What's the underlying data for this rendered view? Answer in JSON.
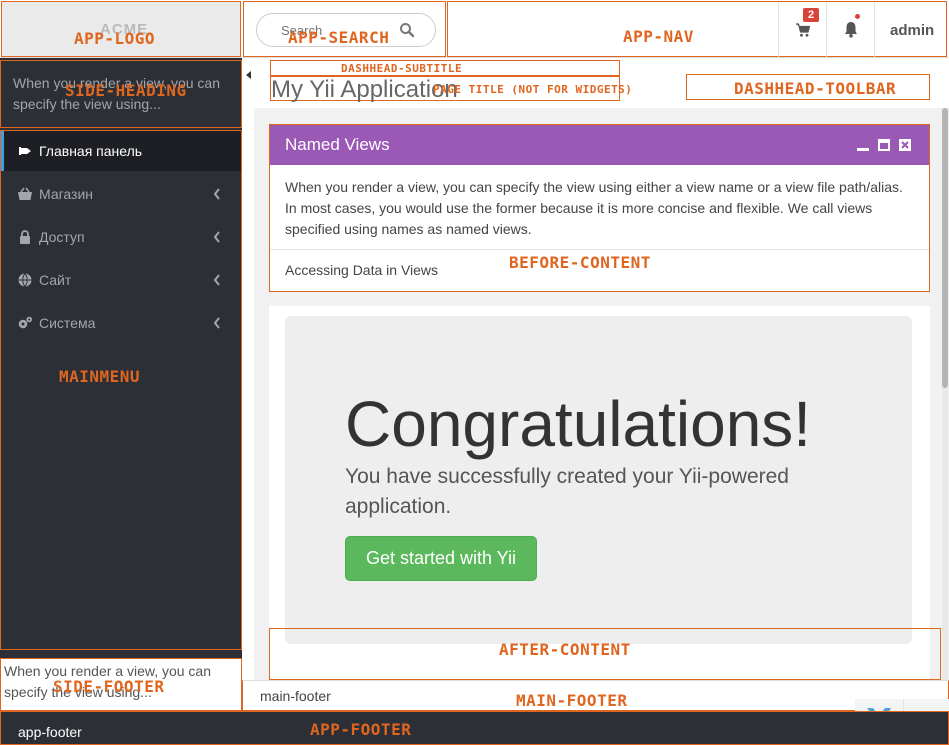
{
  "header": {
    "logo_text": "ACME",
    "search_placeholder": "Search",
    "cart_badge": "2",
    "user_name": "admin"
  },
  "sidebar": {
    "heading": "When you render a view, you can specify the view using...",
    "items": [
      {
        "label": "Главная панель",
        "icon": "dashboard-icon",
        "active": true
      },
      {
        "label": "Магазин",
        "icon": "basket-icon"
      },
      {
        "label": "Доступ",
        "icon": "lock-icon"
      },
      {
        "label": "Сайт",
        "icon": "globe-icon"
      },
      {
        "label": "Система",
        "icon": "gears-icon"
      }
    ],
    "footer": "When you render a view, you can specify the view using..."
  },
  "dashhead": {
    "title": "My Yii Application"
  },
  "panel": {
    "title": "Named Views",
    "body": "When you render a view, you can specify the view using either a view name or a view file path/alias. In most cases, you would use the former because it is more concise and flexible. We call views specified using names as named views.",
    "footer": "Accessing Data in Views",
    "color": "#9b59b6"
  },
  "jumbotron": {
    "title": "Congratulations!",
    "lead": "You have successfully created your Yii-powered application.",
    "button": "Get started with Yii",
    "button_color": "#5cb85c"
  },
  "main_footer": "main-footer",
  "app_footer": "app-footer",
  "annotations": {
    "app_logo": "APP-LOGO",
    "app_search": "APP-SEARCH",
    "app_nav": "APP-NAV",
    "side_heading": "SIDE-HEADING",
    "mainmenu": "MAINMENU",
    "side_footer": "SIDE-FOOTER",
    "dashhead_subtitle": "DASHHEAD-SUBTITLE",
    "page_title": "PAGE TITLE (NOT FOR WIDGETS)",
    "dashhead_toolbar": "DASHHEAD-TOOLBAR",
    "before_content": "BEFORE-CONTENT",
    "after_content": "AFTER-CONTENT",
    "main_footer": "MAIN-FOOTER",
    "app_footer": "APP-FOOTER"
  },
  "colors": {
    "annotation": "#e0651f",
    "sidebar_bg": "#2c2f36",
    "active_accent": "#3aa0e8",
    "badge": "#d9443a"
  }
}
